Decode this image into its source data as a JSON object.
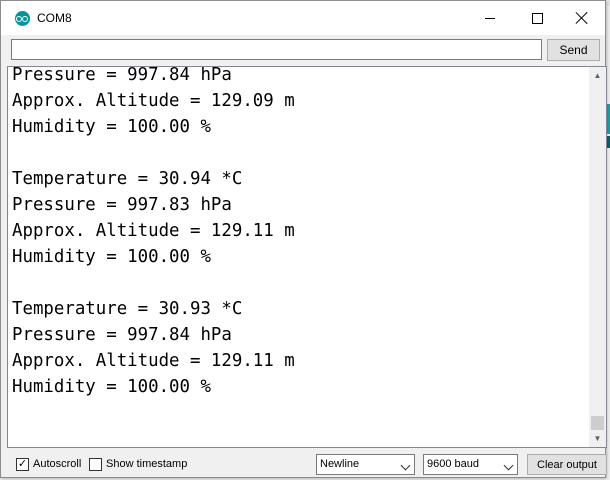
{
  "window": {
    "title": "COM8"
  },
  "send": {
    "input_value": "",
    "button_label": "Send"
  },
  "output": {
    "lines": [
      "Pressure = 997.84 hPa",
      "Approx. Altitude = 129.09 m",
      "Humidity = 100.00 %",
      "",
      "Temperature = 30.94 *C",
      "Pressure = 997.83 hPa",
      "Approx. Altitude = 129.11 m",
      "Humidity = 100.00 %",
      "",
      "Temperature = 30.93 *C",
      "Pressure = 997.84 hPa",
      "Approx. Altitude = 129.11 m",
      "Humidity = 100.00 %"
    ],
    "scroll_position": 1.0
  },
  "footer": {
    "autoscroll": {
      "label": "Autoscroll",
      "checked": true
    },
    "timestamp": {
      "label": "Show timestamp",
      "checked": false
    },
    "line_ending": {
      "selected": "Newline"
    },
    "baud": {
      "selected": "9600 baud"
    },
    "clear_label": "Clear output"
  },
  "icons": {
    "app": "arduino-icon",
    "minimize": "minimize-icon",
    "maximize": "maximize-icon",
    "close": "close-icon"
  },
  "colors": {
    "accent": "#00979c"
  }
}
